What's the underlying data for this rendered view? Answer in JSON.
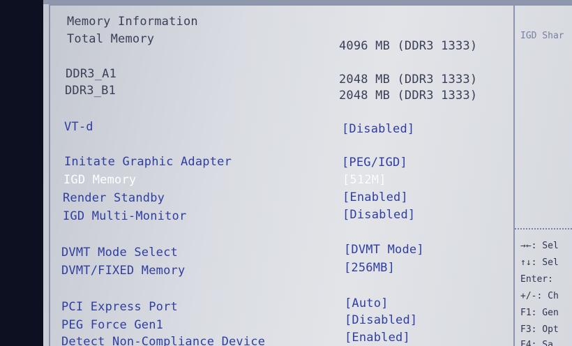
{
  "main": {
    "section_title": "Memory Information",
    "rows": [
      {
        "label": "Total Memory",
        "value": "4096 MB (DDR3 1333)"
      },
      {
        "label": "DDR3_A1",
        "value": "2048 MB (DDR3 1333)"
      },
      {
        "label": "DDR3_B1",
        "value": "2048 MB (DDR3 1333)"
      }
    ],
    "settings": [
      {
        "label": "VT-d",
        "value": "[Disabled]"
      },
      {
        "label": "Initate Graphic Adapter",
        "value": "[PEG/IGD]"
      },
      {
        "label": "IGD Memory",
        "value": "[512M]",
        "selected": true
      },
      {
        "label": "Render Standby",
        "value": "[Enabled]"
      },
      {
        "label": "IGD Multi-Monitor",
        "value": "[Disabled]"
      },
      {
        "label": "DVMT Mode Select",
        "value": "[DVMT Mode]"
      },
      {
        "label": "DVMT/FIXED Memory",
        "value": "[256MB]"
      },
      {
        "label": "PCI Express Port",
        "value": "[Auto]"
      },
      {
        "label": "PEG Force Gen1",
        "value": "[Disabled]"
      },
      {
        "label": "Detect Non-Compliance Device",
        "value": "[Enabled]"
      }
    ]
  },
  "help_panel": {
    "description": "IGD Shar",
    "keys": [
      "→←: Sel",
      "↑↓: Sel",
      "Enter:",
      "+/-: Ch",
      "F1: Gen",
      "F3: Opt",
      "F4: Sa"
    ]
  },
  "colors": {
    "background": "#d9dce2",
    "static_text": "#3a3f58",
    "setting_text": "#2f3ea0",
    "selected_text": "#ffffff",
    "frame": "#8b93ad"
  }
}
